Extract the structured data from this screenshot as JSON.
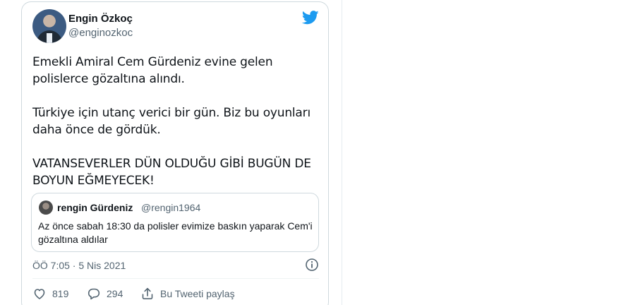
{
  "tweet": {
    "author_name": "Engin Özkoç",
    "author_handle": "@enginozkoc",
    "paragraphs": [
      "Emekli Amiral Cem Gürdeniz evine gelen polislerce gözaltına alındı.",
      "Türkiye için utanç verici bir gün. Biz bu oyunları daha önce de gördük.",
      "VATANSEVERLER DÜN OLDUĞU GİBİ BUGÜN DE BOYUN EĞMEYECEK!"
    ],
    "timestamp": "ÖÖ 7:05 · 5 Nis 2021"
  },
  "quoted_tweet": {
    "author_name": "rengin Gürdeniz",
    "author_handle": "@rengin1964",
    "text": "Az önce sabah 18:30 da polisler evimize baskın yaparak Cem'i gözaltına aldılar"
  },
  "actions": {
    "like_count": "819",
    "reply_count": "294",
    "share_label": "Bu Tweeti paylaş"
  },
  "icons": {
    "brand": "twitter-bird-icon",
    "info": "info-icon",
    "like": "heart-icon",
    "reply": "reply-icon",
    "share": "share-icon"
  },
  "colors": {
    "twitter_blue": "#1d9bf0",
    "secondary_text": "#536471",
    "border": "#cfd9de"
  }
}
